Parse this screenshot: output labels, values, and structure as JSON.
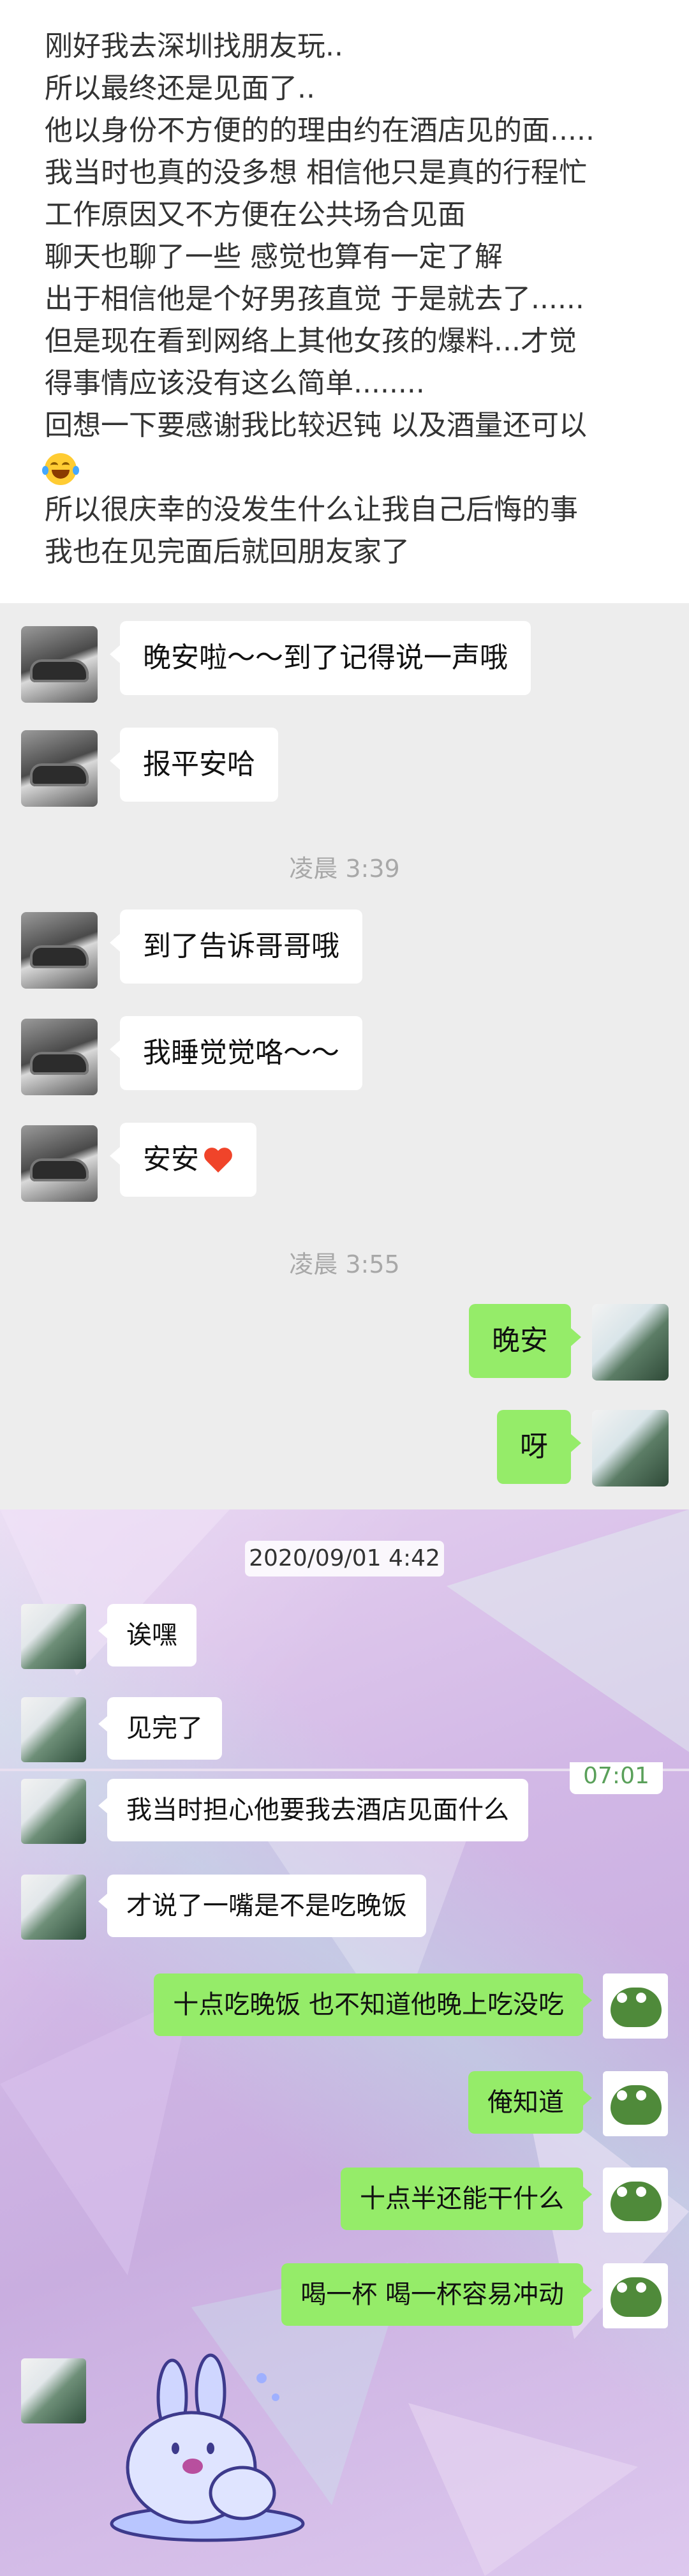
{
  "post": {
    "lines": [
      "刚好我去深圳找朋友玩..",
      "所以最终还是见面了..",
      "他以身份不方便的的理由约在酒店见的面.....",
      "我当时也真的没多想 相信他只是真的行程忙",
      "工作原因又不方便在公共场合见面",
      "聊天也聊了一些 感觉也算有一定了解",
      "出于相信他是个好男孩直觉 于是就去了......",
      "但是现在看到网络上其他女孩的爆料...才觉",
      "得事情应该没有这么简单........",
      "回想一下要感谢我比较迟钝 以及酒量还可以",
      "所以很庆幸的没发生什么让我自己后悔的事",
      "我也在见完面后就回朋友家了"
    ],
    "emoji": "laughing-tears-emoji"
  },
  "chat_a": {
    "messages_1": [
      {
        "side": "left",
        "text": "晚安啦～～到了记得说一声哦"
      },
      {
        "side": "left",
        "text": "报平安哈"
      }
    ],
    "time_1": "凌晨 3:39",
    "messages_2": [
      {
        "side": "left",
        "text": "到了告诉哥哥哦"
      },
      {
        "side": "left",
        "text": "我睡觉觉咯～～"
      },
      {
        "side": "left",
        "text": "安安",
        "icon": "red-heart-icon"
      }
    ],
    "time_2": "凌晨 3:55",
    "messages_3": [
      {
        "side": "right",
        "text": "晚安"
      },
      {
        "side": "right",
        "text": "呀"
      }
    ]
  },
  "chat_b": {
    "date": "2020/09/01 4:42",
    "overlap_time": "07:01",
    "messages_1": [
      {
        "side": "left",
        "text": "诶嘿"
      },
      {
        "side": "left",
        "text": "见完了"
      }
    ],
    "messages_2": [
      {
        "side": "left",
        "text": "我当时担心他要我去酒店见面什么"
      },
      {
        "side": "left",
        "text": "才说了一嘴是不是吃晚饭"
      },
      {
        "side": "right",
        "text": "十点吃晚饭 也不知道他晚上吃没吃"
      },
      {
        "side": "right",
        "text": "俺知道"
      },
      {
        "side": "right",
        "text": "十点半还能干什么"
      },
      {
        "side": "right",
        "text": "喝一杯 喝一杯容易冲动"
      }
    ],
    "sticker": "bunny-sticker"
  },
  "colors": {
    "sent_bubble": "#95ec69",
    "received_bubble": "#ffffff",
    "chat_bg_gray": "#ededed",
    "time_text": "#a8a8a8"
  }
}
